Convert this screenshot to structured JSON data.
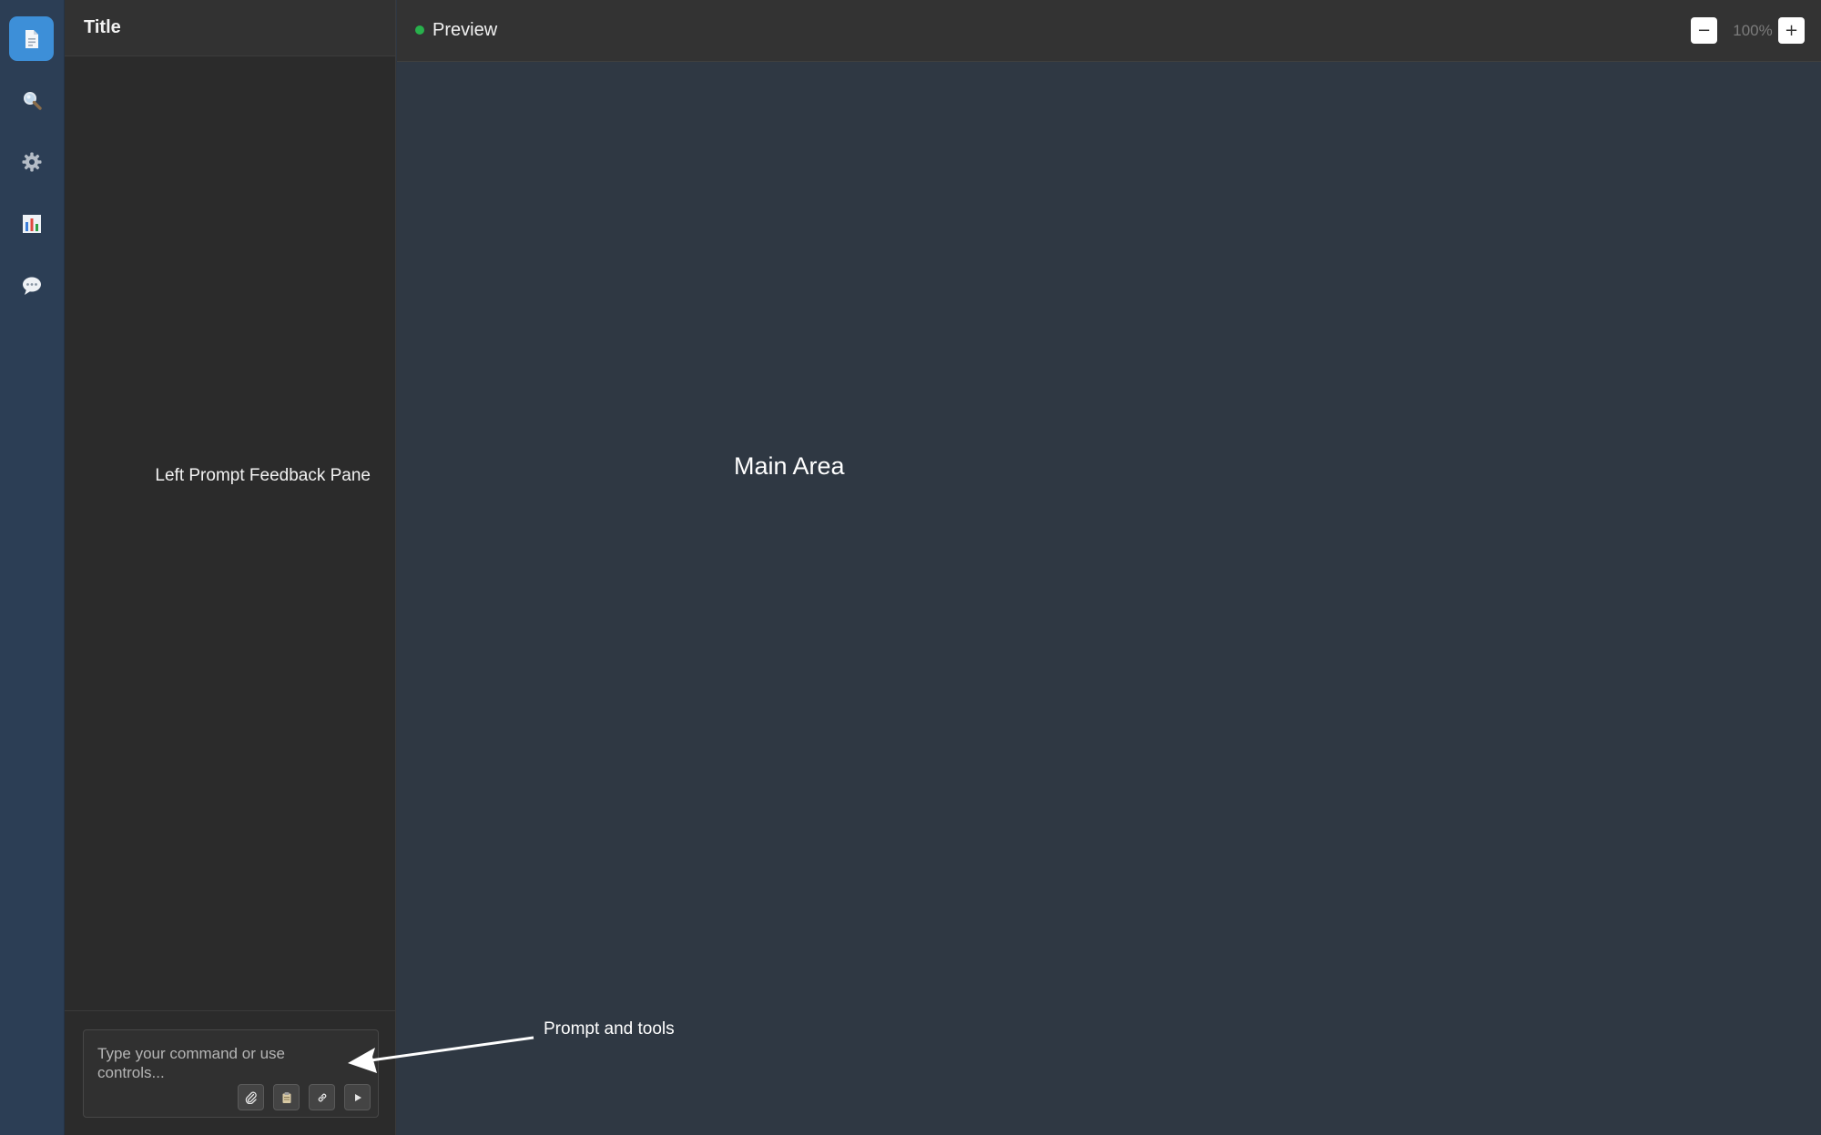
{
  "rail": {
    "items": [
      {
        "name": "document",
        "icon": "document-icon",
        "active": true
      },
      {
        "name": "search",
        "icon": "search-icon",
        "active": false
      },
      {
        "name": "settings",
        "icon": "gear-icon",
        "active": false
      },
      {
        "name": "analytics",
        "icon": "bar-chart-icon",
        "active": false
      },
      {
        "name": "chat",
        "icon": "chat-bubble-icon",
        "active": false
      }
    ]
  },
  "left_pane": {
    "title": "Title",
    "feedback_label": "Left Prompt Feedback Pane",
    "prompt": {
      "placeholder": "Type your command or use controls...",
      "value": "",
      "tools": [
        {
          "name": "attach",
          "icon": "paperclip-icon"
        },
        {
          "name": "clipboard",
          "icon": "clipboard-icon"
        },
        {
          "name": "link",
          "icon": "link-icon"
        },
        {
          "name": "run",
          "icon": "play-icon"
        }
      ]
    }
  },
  "main": {
    "header": {
      "status_color": "#28b14c",
      "preview_label": "Preview",
      "zoom_out_label": "−",
      "zoom_level": "100%",
      "zoom_in_label": "+"
    },
    "label": "Main Area"
  },
  "annotation": {
    "label": "Prompt and tools"
  },
  "colors": {
    "accent": "#3d8fd8",
    "rail": "#2c3e55",
    "left_pane": "#2b2b2b",
    "main": "#2f3843"
  }
}
